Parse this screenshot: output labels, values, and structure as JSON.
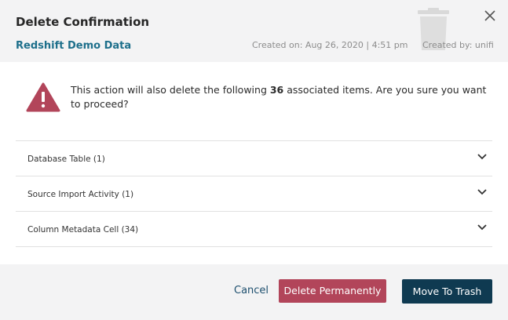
{
  "dialog": {
    "title": "Delete Confirmation",
    "subtitle": "Redshift Demo Data",
    "created_on": "Created on: Aug 26, 2020 | 4:51 pm",
    "created_by": "Created by: unifi"
  },
  "message": {
    "prefix": "This action will also delete the following ",
    "count": "36",
    "suffix": " associated items. Are you sure you want to proceed?"
  },
  "items": [
    {
      "label": "Database Table (1)"
    },
    {
      "label": "Source Import Activity (1)"
    },
    {
      "label": "Column Metadata Cell (34)"
    }
  ],
  "buttons": {
    "cancel": "Cancel",
    "delete_permanently": "Delete Permanently",
    "move_to_trash": "Move To Trash"
  },
  "colors": {
    "link": "#1d6f8b",
    "danger": "#b2455a",
    "primary": "#0f3a51",
    "warning_icon": "#b2455a"
  },
  "icons": [
    "trash-icon",
    "close-icon",
    "warning-icon",
    "chevron-down-icon"
  ]
}
